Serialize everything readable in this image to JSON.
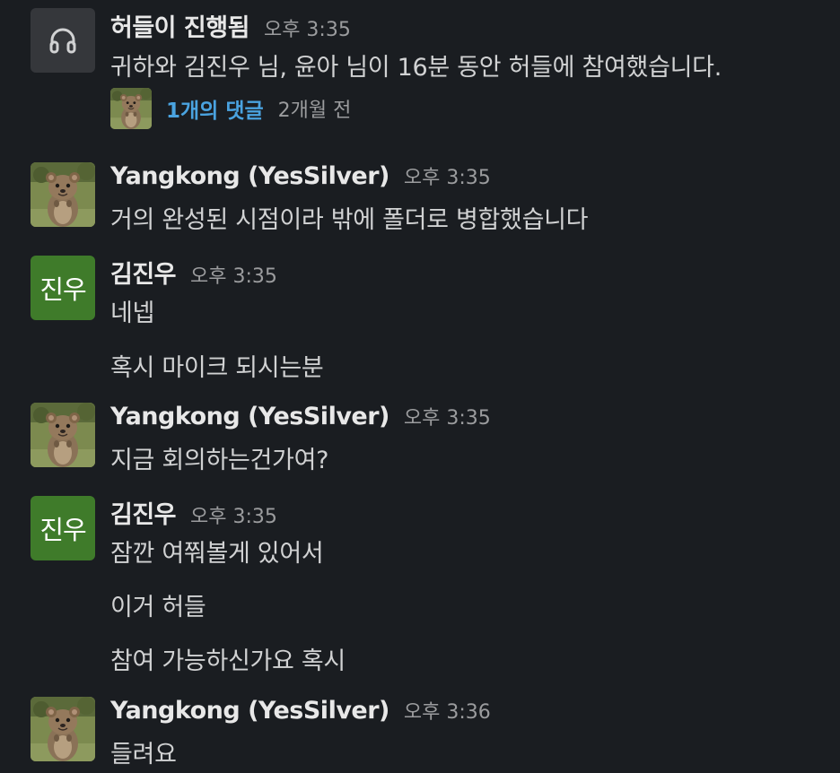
{
  "messages": {
    "huddle": {
      "title": "허들이 진행됨",
      "time": "오후 3:35",
      "text": "귀하와 김진우 님, 윤아 님이 16분 동안 허들에 참여했습니다.",
      "thread": {
        "reply_count": "1개의 댓글",
        "last_reply": "2개월 전"
      }
    },
    "m1": {
      "name": "Yangkong (YesSilver)",
      "time": "오후 3:35",
      "text": "거의 완성된 시점이라 밖에 폴더로 병합했습니다"
    },
    "m2": {
      "name": "김진우",
      "initials": "진우",
      "time": "오후 3:35",
      "lines": [
        "네넵",
        "혹시 마이크 되시는분"
      ]
    },
    "m3": {
      "name": "Yangkong (YesSilver)",
      "time": "오후 3:35",
      "text": "지금 회의하는건가여?"
    },
    "m4": {
      "name": "김진우",
      "initials": "진우",
      "time": "오후 3:35",
      "lines": [
        "잠깐 여쭤볼게 있어서",
        "이거 허들",
        "참여 가능하신가요 혹시"
      ]
    },
    "m5": {
      "name": "Yangkong (YesSilver)",
      "time": "오후 3:36",
      "text": "들려요"
    }
  },
  "colors": {
    "background": "#1a1d21",
    "link": "#4aa3e0",
    "initials_avatar": "#3f7b2a",
    "huddle_icon_bg": "#35373b"
  },
  "icons": {
    "huddle": "headphones-icon",
    "avatar": "quokka-photo"
  }
}
